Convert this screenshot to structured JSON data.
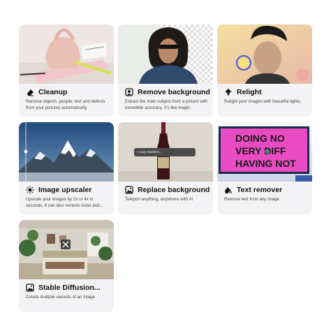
{
  "tools": [
    {
      "title": "Cleanup",
      "icon": "eraser-icon",
      "description": "Remove objects, people, text and defects from your pictures automatically."
    },
    {
      "title": "Remove background",
      "icon": "cutout-icon",
      "description": "Extract the main subject from a picture with incredible accuracy. It's like magic."
    },
    {
      "title": "Relight",
      "icon": "bulb-icon",
      "description": "Relight your images with beautiful lights."
    },
    {
      "title": "Image upscaler",
      "icon": "upscale-icon",
      "description": "Upscale your images by 2x or 4x in seconds. It can also remove noise and..."
    },
    {
      "title": "Replace background",
      "icon": "image-swap-icon",
      "description": "Teleport anything, anywhere with AI",
      "thumb_caption": "A cozy marble k..."
    },
    {
      "title": "Text remover",
      "icon": "text-eraser-icon",
      "description": "Remove text from any image",
      "thumb_text": [
        "DOING NO",
        "VERY DIFF",
        "HAVING NOT"
      ]
    },
    {
      "title": "Stable Diffusion...",
      "icon": "image-icon",
      "description": "Create multiple variants of an image"
    }
  ]
}
